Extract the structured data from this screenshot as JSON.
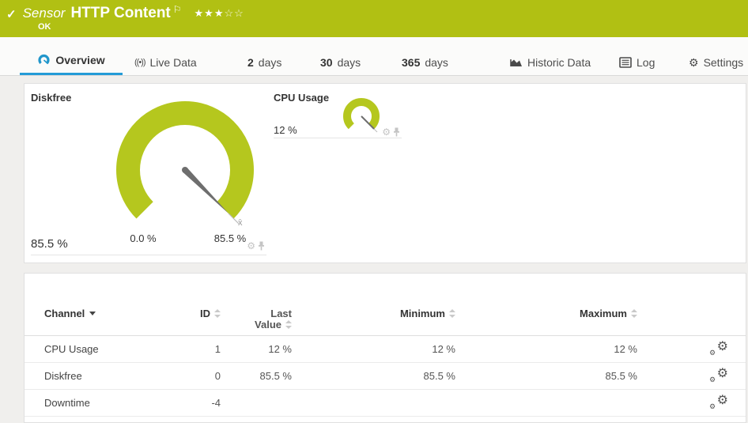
{
  "header": {
    "check_icon": "✓",
    "kind_label": "Sensor",
    "title": "HTTP Content",
    "flag_icon": "⚐",
    "stars_filled": "★★★",
    "stars_empty": "☆☆",
    "status": "OK"
  },
  "tabs": {
    "overview": "Overview",
    "live_data": "Live Data",
    "live_icon": "((•))",
    "days2_num": "2",
    "days2_unit": "days",
    "days30_num": "30",
    "days30_unit": "days",
    "days365_num": "365",
    "days365_unit": "days",
    "historic": "Historic Data",
    "log": "Log",
    "settings": "Settings",
    "settings_icon": "⚙"
  },
  "gauges": {
    "diskfree": {
      "title": "Diskfree",
      "value": "85.5 %",
      "scale_min": "0.0 %",
      "scale_max": "85.5 %",
      "mean_marker": "x̄"
    },
    "cpu": {
      "title": "CPU Usage",
      "value": "12 %"
    }
  },
  "panel_icons": {
    "gear": "⚙"
  },
  "table": {
    "headers": {
      "channel": "Channel",
      "id": "ID",
      "last1": "Last",
      "last2": "Value",
      "minimum": "Minimum",
      "maximum": "Maximum"
    },
    "rows": [
      {
        "channel": "CPU Usage",
        "id": "1",
        "last": "12 %",
        "min": "12 %",
        "max": "12 %"
      },
      {
        "channel": "Diskfree",
        "id": "0",
        "last": "85.5 %",
        "min": "85.5 %",
        "max": "85.5 %"
      },
      {
        "channel": "Downtime",
        "id": "-4",
        "last": "",
        "min": "",
        "max": ""
      }
    ]
  },
  "colors": {
    "status_green": "#b1c013",
    "gauge_green": "#b5c71e",
    "accent_blue": "#2196cb"
  }
}
